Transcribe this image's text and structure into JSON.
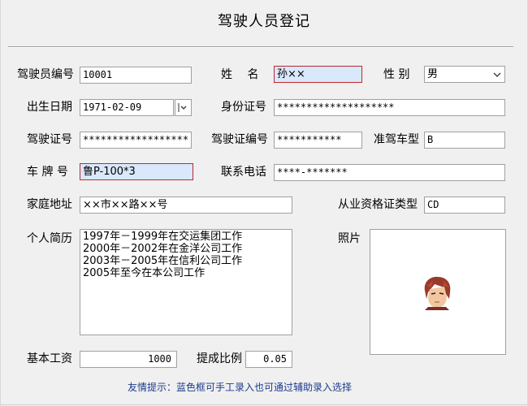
{
  "title": "驾驶人员登记",
  "fields": {
    "driver_no": {
      "label": "驾驶员编号",
      "value": "10001"
    },
    "name": {
      "label": "姓　 名",
      "value": "孙××"
    },
    "gender": {
      "label": "性 别",
      "value": "男"
    },
    "birth_date": {
      "label": "出生日期",
      "value": "1971-02-09"
    },
    "id_no": {
      "label": "身份证号",
      "value": "********************"
    },
    "driver_license_no": {
      "label": "驾驶证号",
      "value": "******************"
    },
    "license_file_no": {
      "label": "驾驶证编号",
      "value": "***********"
    },
    "vehicle_type": {
      "label": "准驾车型",
      "value": "B"
    },
    "plate_no": {
      "label": "车 牌 号",
      "value": "鲁P-100*3"
    },
    "phone": {
      "label": "联系电话",
      "value": "****-*******"
    },
    "address": {
      "label": "家庭地址",
      "value": "××市××路××号"
    },
    "cert_type": {
      "label": "从业资格证类型",
      "value": "CD"
    },
    "resume": {
      "label": "个人简历",
      "lines": [
        "1997年－1999年在交运集团工作",
        "2000年－2002年在金洋公司工作",
        "2003年－2005年在信利公司工作",
        "2005年至今在本公司工作"
      ]
    },
    "photo": {
      "label": "照片"
    },
    "base_salary": {
      "label": "基本工资",
      "value": "1000"
    },
    "commission_ratio": {
      "label": "提成比例",
      "value": "0.05"
    }
  },
  "hint": "友情提示：蓝色框可手工录入也可通过辅助录入选择",
  "icons": {
    "combo_arrow": "chevron-down-icon",
    "date_picker": "calendar-dropdown-icon",
    "photo": "cartoon-avatar"
  },
  "colors": {
    "blue_input": "#d9e8fb",
    "red_border": "#c0282d",
    "hint_text": "#1c3b8c"
  }
}
